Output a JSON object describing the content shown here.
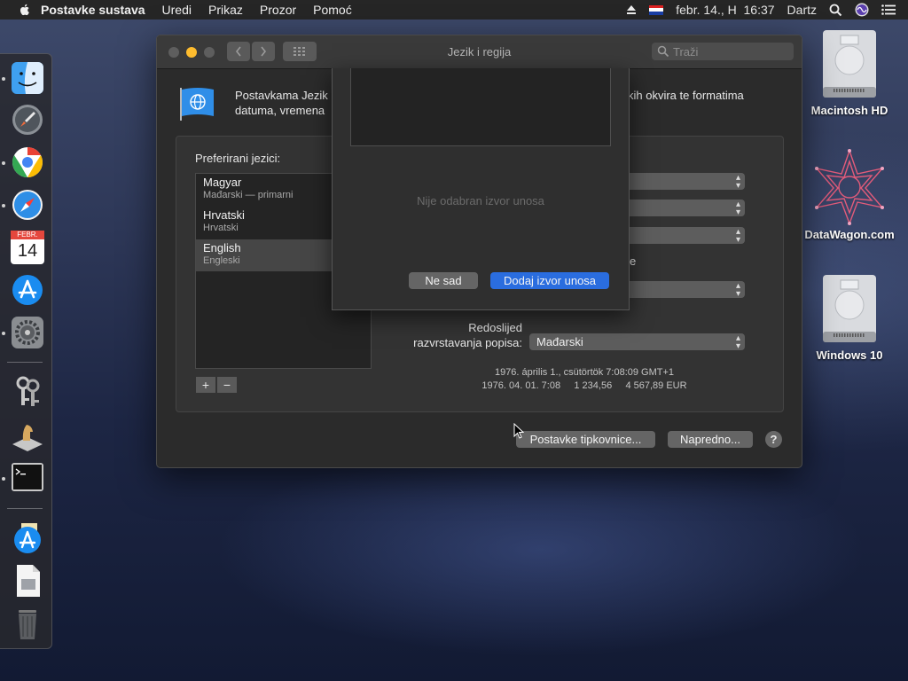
{
  "menubar": {
    "app_name": "Postavke sustava",
    "items": [
      "Uredi",
      "Prikaz",
      "Prozor",
      "Pomoć"
    ],
    "clock": "febr. 14., H  16:37",
    "user": "Dartz"
  },
  "window": {
    "title": "Jezik i regija",
    "search_placeholder": "Traži",
    "header_line1_left": "Postavkama Jezik",
    "header_line2_left": "datuma, vremena",
    "header_line1_right": "kih okvira te formatima",
    "preferred_label": "Preferirani jezici:",
    "languages": [
      {
        "name": "Magyar",
        "sub": "Mađarski — primarni"
      },
      {
        "name": "Hrvatski",
        "sub": "Hrvatski"
      },
      {
        "name": "English",
        "sub": "Engleski"
      }
    ],
    "add_label": "+",
    "remove_label": "−",
    "partial_label_e": "e",
    "sort_label_line1": "Redoslijed",
    "sort_label_line2": "razvrstavanja popisa:",
    "sort_value": "Mađarski",
    "sample_line1": "1976. április 1., csütörtök 7:08:09 GMT+1",
    "sample_line2": "1976. 04. 01. 7:08     1 234,56     4 567,89 EUR",
    "keyboard_button": "Postavke tipkovnice...",
    "advanced_button": "Napredno...",
    "help_label": "?"
  },
  "sheet": {
    "empty_text": "Nije odabran izvor unosa",
    "cancel_button": "Ne sad",
    "add_button": "Dodaj izvor unosa"
  },
  "desktop": {
    "icons": [
      {
        "label": "Macintosh HD"
      },
      {
        "label": "DataWagon.com"
      },
      {
        "label": "Windows 10"
      }
    ]
  },
  "dock": {
    "calendar_month": "FEBR.",
    "calendar_day": "14"
  },
  "colors": {
    "accent": "#2a6ddf",
    "close": "#ff5f57",
    "minimize": "#febc2e",
    "zoom": "#28c840"
  }
}
